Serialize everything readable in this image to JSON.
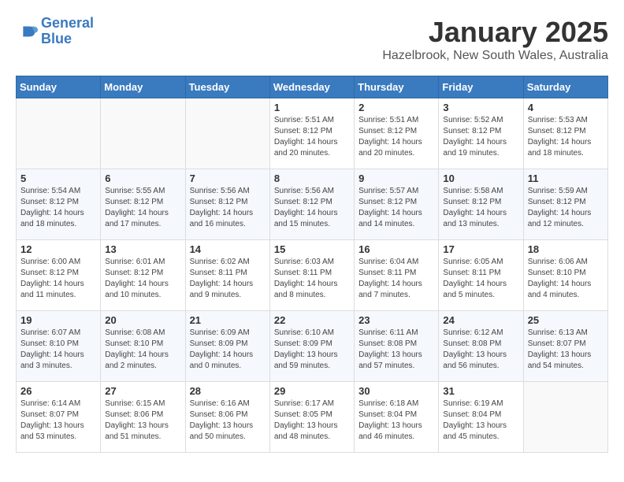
{
  "header": {
    "logo_line1": "General",
    "logo_line2": "Blue",
    "title": "January 2025",
    "subtitle": "Hazelbrook, New South Wales, Australia"
  },
  "weekdays": [
    "Sunday",
    "Monday",
    "Tuesday",
    "Wednesday",
    "Thursday",
    "Friday",
    "Saturday"
  ],
  "weeks": [
    [
      {
        "day": "",
        "info": ""
      },
      {
        "day": "",
        "info": ""
      },
      {
        "day": "",
        "info": ""
      },
      {
        "day": "1",
        "info": "Sunrise: 5:51 AM\nSunset: 8:12 PM\nDaylight: 14 hours\nand 20 minutes."
      },
      {
        "day": "2",
        "info": "Sunrise: 5:51 AM\nSunset: 8:12 PM\nDaylight: 14 hours\nand 20 minutes."
      },
      {
        "day": "3",
        "info": "Sunrise: 5:52 AM\nSunset: 8:12 PM\nDaylight: 14 hours\nand 19 minutes."
      },
      {
        "day": "4",
        "info": "Sunrise: 5:53 AM\nSunset: 8:12 PM\nDaylight: 14 hours\nand 18 minutes."
      }
    ],
    [
      {
        "day": "5",
        "info": "Sunrise: 5:54 AM\nSunset: 8:12 PM\nDaylight: 14 hours\nand 18 minutes."
      },
      {
        "day": "6",
        "info": "Sunrise: 5:55 AM\nSunset: 8:12 PM\nDaylight: 14 hours\nand 17 minutes."
      },
      {
        "day": "7",
        "info": "Sunrise: 5:56 AM\nSunset: 8:12 PM\nDaylight: 14 hours\nand 16 minutes."
      },
      {
        "day": "8",
        "info": "Sunrise: 5:56 AM\nSunset: 8:12 PM\nDaylight: 14 hours\nand 15 minutes."
      },
      {
        "day": "9",
        "info": "Sunrise: 5:57 AM\nSunset: 8:12 PM\nDaylight: 14 hours\nand 14 minutes."
      },
      {
        "day": "10",
        "info": "Sunrise: 5:58 AM\nSunset: 8:12 PM\nDaylight: 14 hours\nand 13 minutes."
      },
      {
        "day": "11",
        "info": "Sunrise: 5:59 AM\nSunset: 8:12 PM\nDaylight: 14 hours\nand 12 minutes."
      }
    ],
    [
      {
        "day": "12",
        "info": "Sunrise: 6:00 AM\nSunset: 8:12 PM\nDaylight: 14 hours\nand 11 minutes."
      },
      {
        "day": "13",
        "info": "Sunrise: 6:01 AM\nSunset: 8:12 PM\nDaylight: 14 hours\nand 10 minutes."
      },
      {
        "day": "14",
        "info": "Sunrise: 6:02 AM\nSunset: 8:11 PM\nDaylight: 14 hours\nand 9 minutes."
      },
      {
        "day": "15",
        "info": "Sunrise: 6:03 AM\nSunset: 8:11 PM\nDaylight: 14 hours\nand 8 minutes."
      },
      {
        "day": "16",
        "info": "Sunrise: 6:04 AM\nSunset: 8:11 PM\nDaylight: 14 hours\nand 7 minutes."
      },
      {
        "day": "17",
        "info": "Sunrise: 6:05 AM\nSunset: 8:11 PM\nDaylight: 14 hours\nand 5 minutes."
      },
      {
        "day": "18",
        "info": "Sunrise: 6:06 AM\nSunset: 8:10 PM\nDaylight: 14 hours\nand 4 minutes."
      }
    ],
    [
      {
        "day": "19",
        "info": "Sunrise: 6:07 AM\nSunset: 8:10 PM\nDaylight: 14 hours\nand 3 minutes."
      },
      {
        "day": "20",
        "info": "Sunrise: 6:08 AM\nSunset: 8:10 PM\nDaylight: 14 hours\nand 2 minutes."
      },
      {
        "day": "21",
        "info": "Sunrise: 6:09 AM\nSunset: 8:09 PM\nDaylight: 14 hours\nand 0 minutes."
      },
      {
        "day": "22",
        "info": "Sunrise: 6:10 AM\nSunset: 8:09 PM\nDaylight: 13 hours\nand 59 minutes."
      },
      {
        "day": "23",
        "info": "Sunrise: 6:11 AM\nSunset: 8:08 PM\nDaylight: 13 hours\nand 57 minutes."
      },
      {
        "day": "24",
        "info": "Sunrise: 6:12 AM\nSunset: 8:08 PM\nDaylight: 13 hours\nand 56 minutes."
      },
      {
        "day": "25",
        "info": "Sunrise: 6:13 AM\nSunset: 8:07 PM\nDaylight: 13 hours\nand 54 minutes."
      }
    ],
    [
      {
        "day": "26",
        "info": "Sunrise: 6:14 AM\nSunset: 8:07 PM\nDaylight: 13 hours\nand 53 minutes."
      },
      {
        "day": "27",
        "info": "Sunrise: 6:15 AM\nSunset: 8:06 PM\nDaylight: 13 hours\nand 51 minutes."
      },
      {
        "day": "28",
        "info": "Sunrise: 6:16 AM\nSunset: 8:06 PM\nDaylight: 13 hours\nand 50 minutes."
      },
      {
        "day": "29",
        "info": "Sunrise: 6:17 AM\nSunset: 8:05 PM\nDaylight: 13 hours\nand 48 minutes."
      },
      {
        "day": "30",
        "info": "Sunrise: 6:18 AM\nSunset: 8:04 PM\nDaylight: 13 hours\nand 46 minutes."
      },
      {
        "day": "31",
        "info": "Sunrise: 6:19 AM\nSunset: 8:04 PM\nDaylight: 13 hours\nand 45 minutes."
      },
      {
        "day": "",
        "info": ""
      }
    ]
  ]
}
